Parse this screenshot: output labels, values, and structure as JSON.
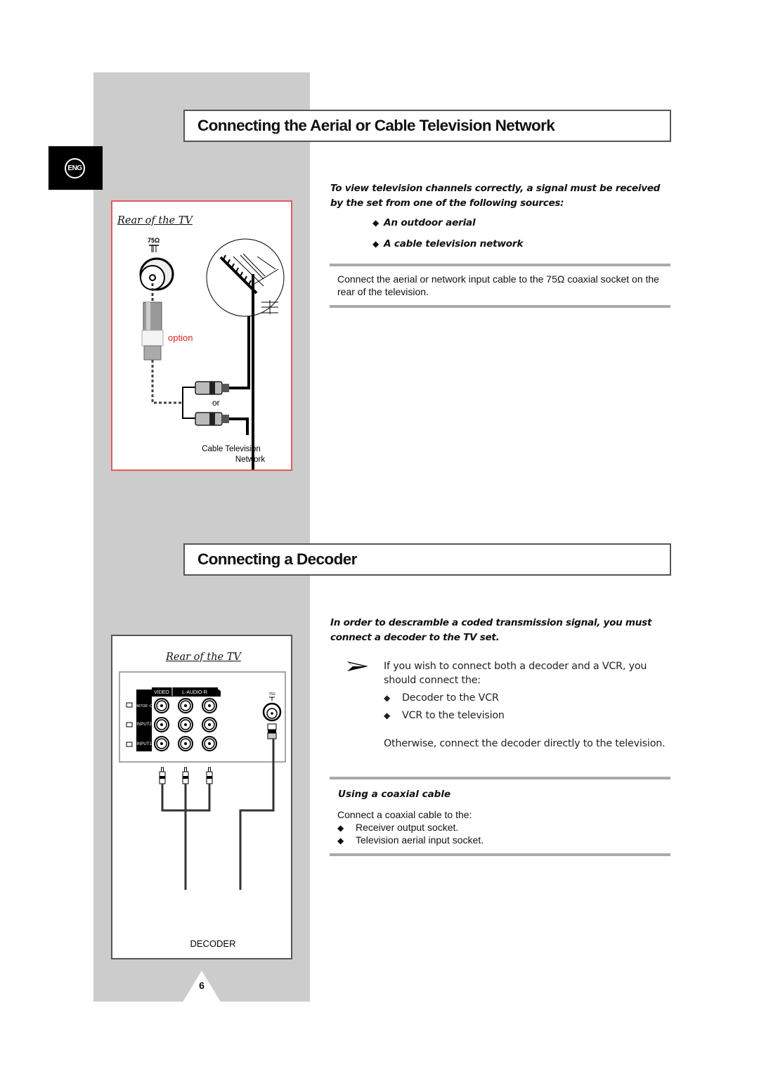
{
  "language_tab": {
    "label": "ENG"
  },
  "section_aerial": {
    "title": "Connecting the Aerial or Cable Television Network",
    "diagram": {
      "heading": "Rear of the TV",
      "socket_label": "75Ω",
      "option_label": "option",
      "or_label": "or",
      "cable_label_line1": "Cable Television",
      "cable_label_line2": "Network",
      "accent_color": "#e55a5a"
    },
    "intro": "To view television channels correctly, a signal must be received by the set from one of the following sources:",
    "sources": [
      "An outdoor aerial",
      "A cable television network"
    ],
    "instruction": "Connect the aerial or network input cable to the 75Ω coaxial socket on the rear of the television."
  },
  "section_decoder": {
    "title": "Connecting a Decoder",
    "diagram": {
      "heading": "Rear of the TV",
      "col_video": "VIDEO",
      "col_audio": "L-AUDIO-R",
      "rows": [
        "MONITOR -OUT",
        "INPUT2",
        "INPUT1"
      ],
      "socket_label": "75Ω",
      "device_label": "DECODER"
    },
    "intro": "In order to descramble a coded transmission signal, you must connect a decoder to the TV set.",
    "note_line1": "If you wish to connect both a decoder and a VCR, you",
    "note_line2": "should connect the:",
    "note_items": [
      "Decoder to the VCR",
      "VCR to the television"
    ],
    "otherwise": "Otherwise, connect the decoder directly to the television.",
    "coax_heading": "Using a coaxial cable",
    "coax_intro": "Connect a coaxial cable to the:",
    "coax_items": [
      "Receiver output socket.",
      "Television aerial input socket."
    ]
  },
  "page_number": "6"
}
